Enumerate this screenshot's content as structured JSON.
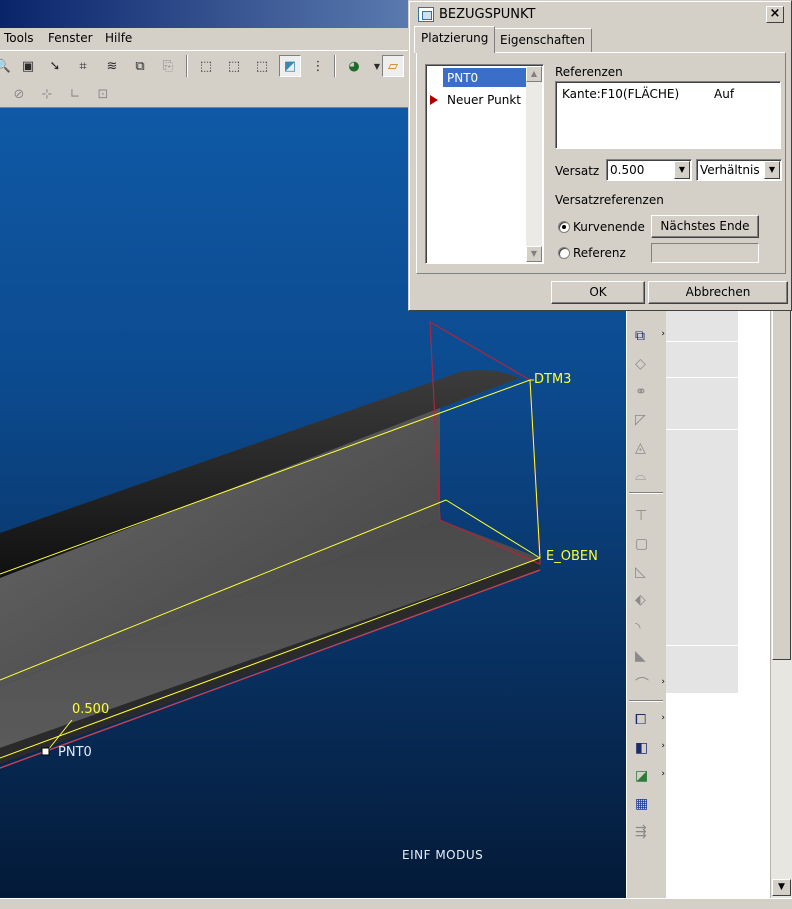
{
  "menubar": {
    "items": [
      "Tools",
      "Fenster",
      "Hilfe"
    ]
  },
  "viewport": {
    "labels": {
      "datum_plane": "DTM3",
      "edge_ref": "E_OBEN",
      "offset_value": "0.500",
      "point": "PNT0"
    },
    "mode_text": "EINF MODUS"
  },
  "dialog": {
    "title": "BEZUGSPUNKT",
    "close_label": "×",
    "tabs": [
      "Platzierung",
      "Eigenschaften"
    ],
    "point_list": [
      "PNT0",
      "Neuer Punkt"
    ],
    "references_label": "Referenzen",
    "reference": {
      "entity": "Kante:F10(FLÄCHE)",
      "constraint": "Auf"
    },
    "offset_label": "Versatz",
    "offset_value": "0.500",
    "offset_type": "Verhältnis",
    "offset_refs_label": "Versatzreferenzen",
    "radio_curve_end": "Kurvenende",
    "next_end_button": "Nächstes Ende",
    "radio_reference": "Referenz",
    "ok_button": "OK",
    "cancel_button": "Abbrechen"
  },
  "colors": {
    "viewport_top": "#0f59a6",
    "viewport_bottom": "#041a38",
    "selection": "#3a6ec8",
    "highlight_yellow": "#ffff33"
  }
}
